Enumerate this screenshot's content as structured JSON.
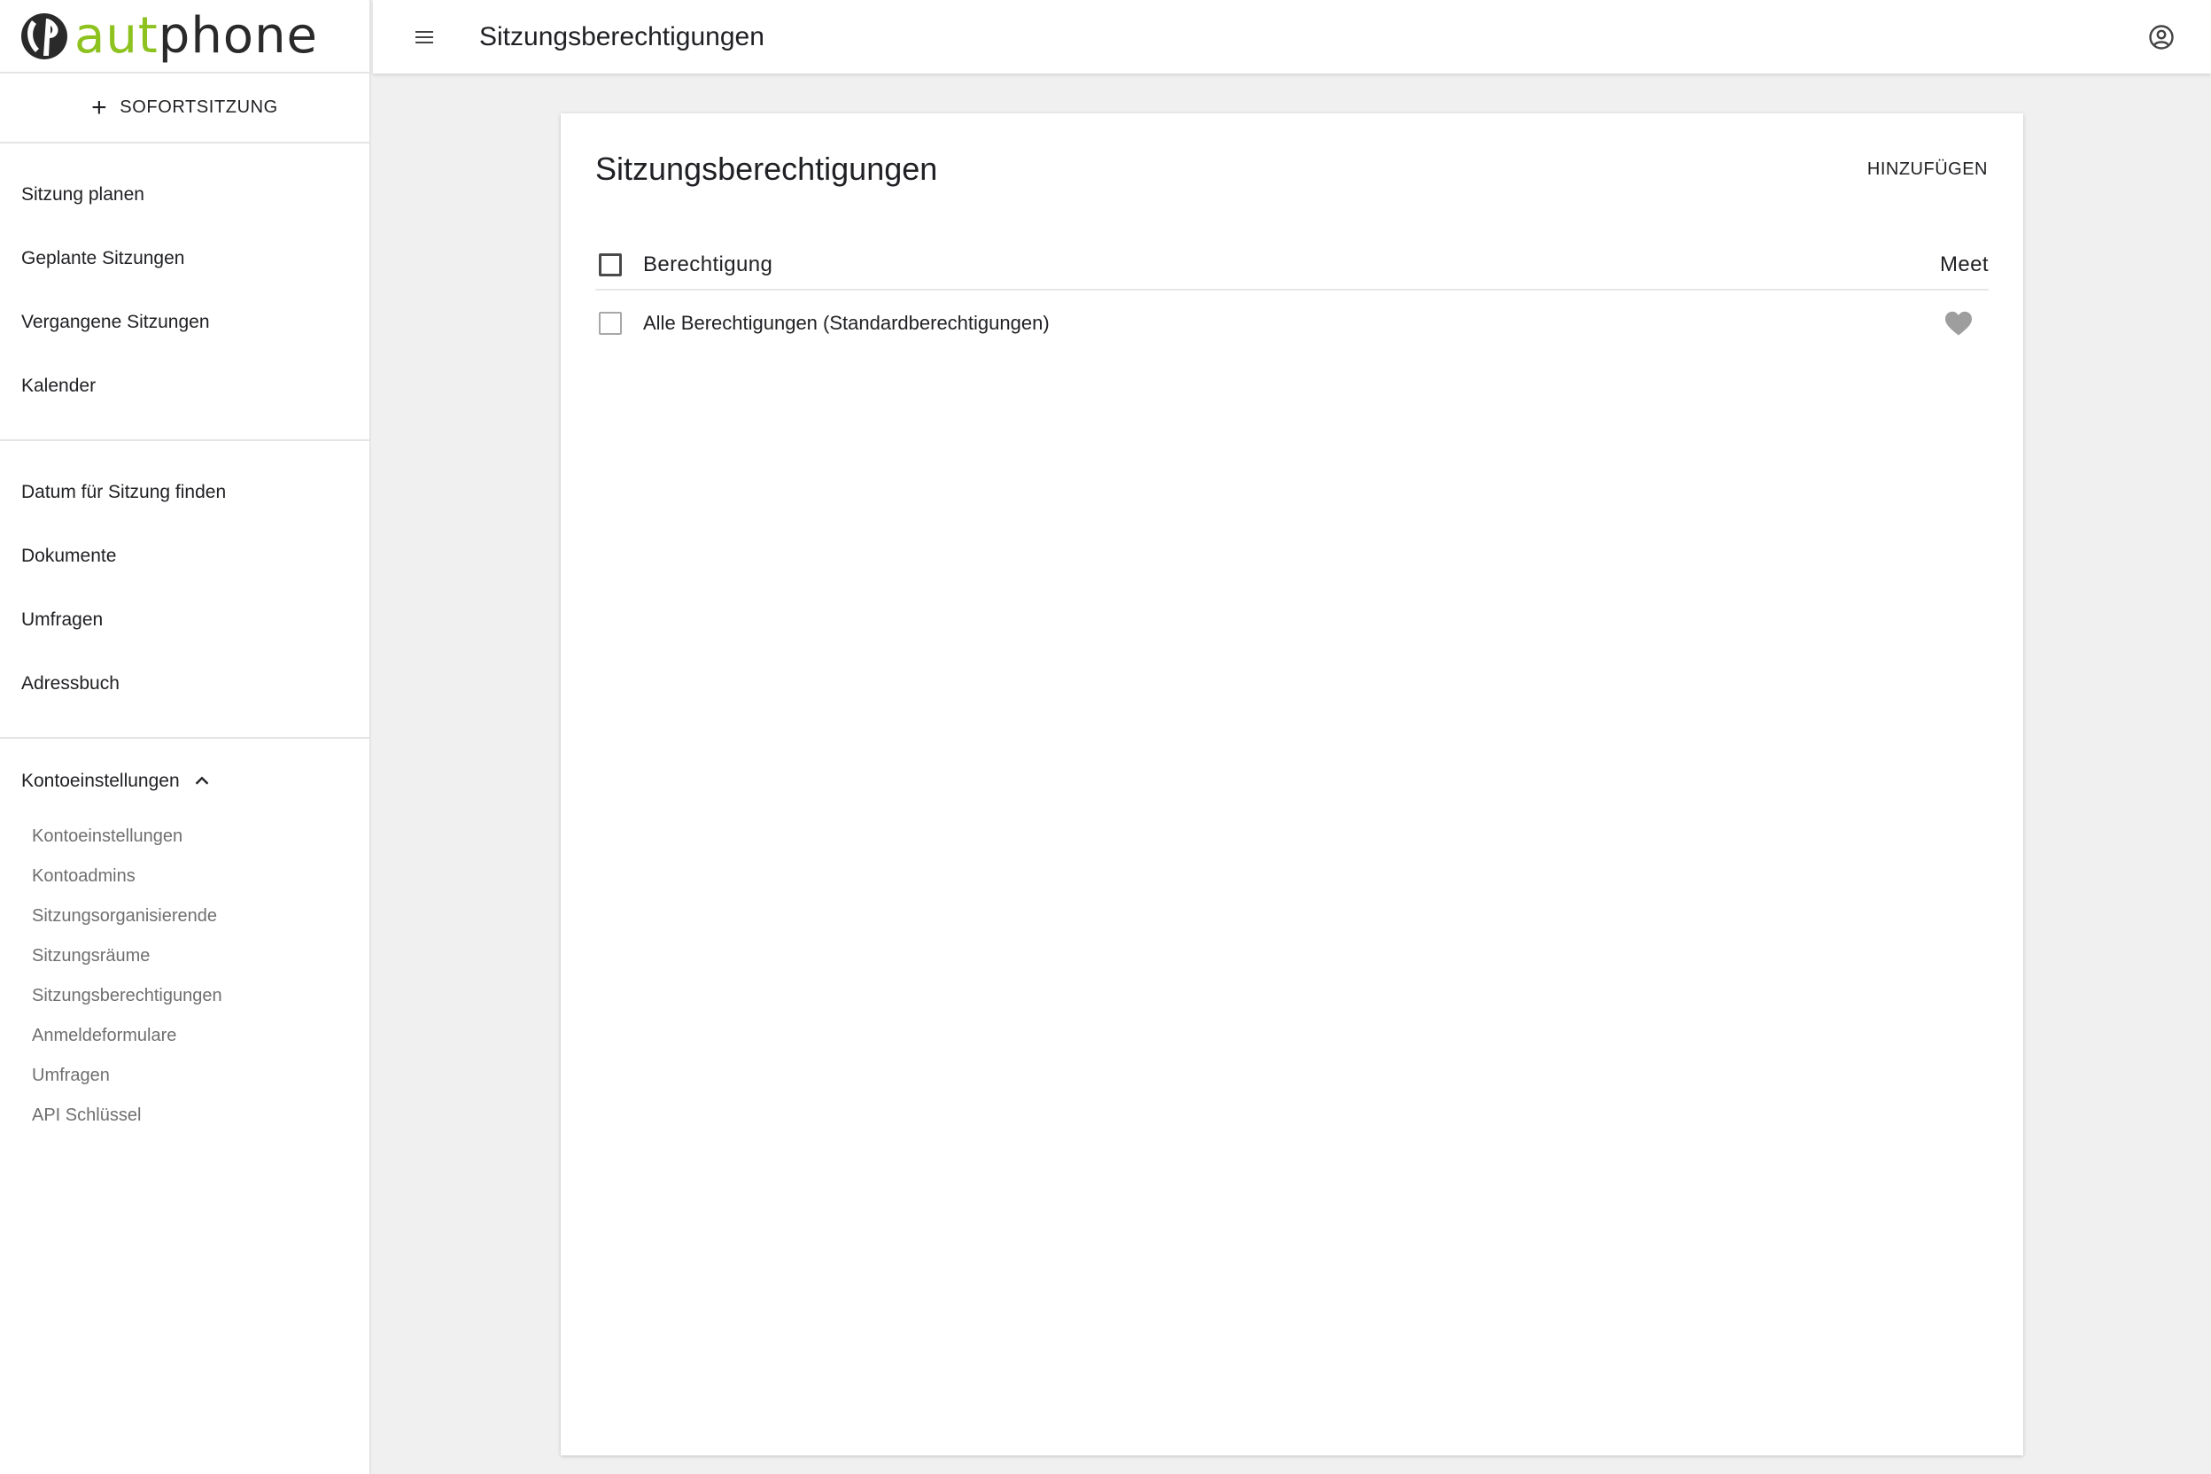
{
  "brand": {
    "text_light": "aut",
    "text_accent": "p",
    "text_rest": "hone",
    "green": "#8dc21f",
    "dark": "#2a2a2a"
  },
  "sidebar": {
    "instant_label": "SOFORTSITZUNG",
    "group1": [
      "Sitzung planen",
      "Geplante Sitzungen",
      "Vergangene Sitzungen",
      "Kalender"
    ],
    "group2": [
      "Datum für Sitzung finden",
      "Dokumente",
      "Umfragen",
      "Adressbuch"
    ],
    "account_header": "Kontoeinstellungen",
    "account_items": [
      "Kontoeinstellungen",
      "Kontoadmins",
      "Sitzungsorganisierende",
      "Sitzungsräume",
      "Sitzungsberechtigungen",
      "Anmeldeformulare",
      "Umfragen",
      "API Schlüssel"
    ]
  },
  "topbar": {
    "title": "Sitzungsberechtigungen",
    "menu_icon": "hamburger-menu-icon",
    "account_icon": "account-circle-icon"
  },
  "card": {
    "title": "Sitzungsberechtigungen",
    "add_label": "HINZUFÜGEN",
    "columns": {
      "name": "Berechtigung",
      "meet": "Meet"
    },
    "rows": [
      {
        "name": "Alle Berechtigungen (Standardberechtigungen)",
        "meet_icon": "heart-icon",
        "meet_color": "#9e9e9e"
      }
    ]
  }
}
